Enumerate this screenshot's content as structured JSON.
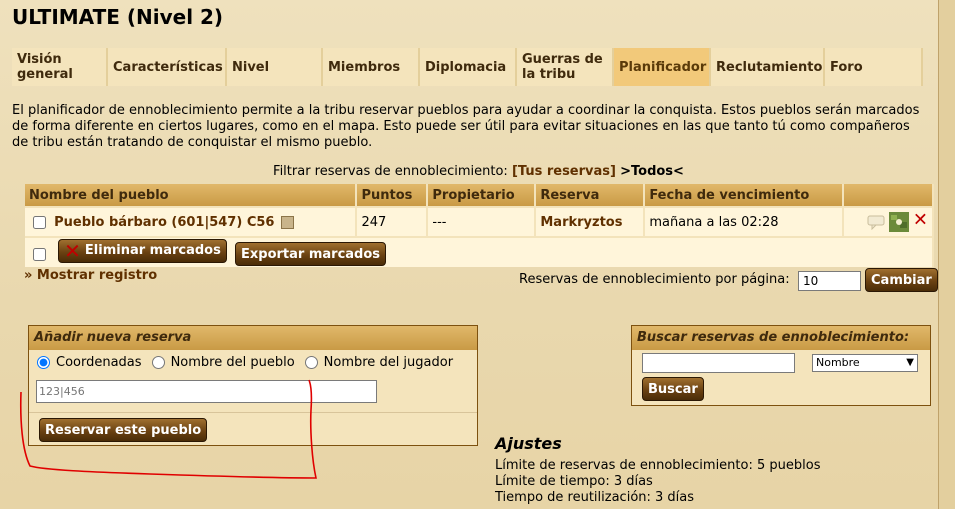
{
  "page_title": "ULTIMATE (Nivel 2)",
  "tabs": [
    {
      "label": "Visión general",
      "active": false
    },
    {
      "label": "Características",
      "active": false
    },
    {
      "label": "Nivel",
      "active": false
    },
    {
      "label": "Miembros",
      "active": false
    },
    {
      "label": "Diplomacia",
      "active": false
    },
    {
      "label": "Guerras de la tribu",
      "active": false
    },
    {
      "label": "Planificador",
      "active": true
    },
    {
      "label": "Reclutamiento",
      "active": false
    },
    {
      "label": "Foro",
      "active": false
    }
  ],
  "intro_text": "El planificador de ennoblecimiento permite a la tribu reservar pueblos para ayudar a coordinar la conquista. Estos pueblos serán marcados de forma diferente en ciertos lugares, como en el mapa. Esto puede ser útil para evitar situaciones en las que tanto tú como compañeros de tribu están tratando de conquistar el mismo pueblo.",
  "filter": {
    "label": "Filtrar reservas de ennoblecimiento:",
    "option_mine": "[Tus reservas]",
    "option_all": ">Todos<"
  },
  "table": {
    "headers": [
      "Nombre del pueblo",
      "Puntos",
      "Propietario",
      "Reserva",
      "Fecha de vencimiento",
      ""
    ],
    "rows": [
      {
        "village": "Pueblo bárbaro (601|547) C56",
        "points": "247",
        "owner": "---",
        "reserved_by": "Markryztos",
        "expires": "mañana a las 02:28"
      }
    ],
    "delete_marked_label": "Eliminar marcados",
    "export_marked_label": "Exportar marcados"
  },
  "show_log_label": "» Mostrar registro",
  "per_page": {
    "label": "Reservas de ennoblecimiento por página:",
    "value": "10",
    "button_label": "Cambiar"
  },
  "add_reservation": {
    "title": "Añadir nueva reserva",
    "radio_options": [
      "Coordenadas",
      "Nombre del pueblo",
      "Nombre del jugador"
    ],
    "selected_option": "Coordenadas",
    "input_placeholder": "123|456",
    "submit_label": "Reservar este pueblo"
  },
  "search_reservations": {
    "title": "Buscar reservas de ennoblecimiento:",
    "select_value": "Nombre",
    "button_label": "Buscar"
  },
  "settings": {
    "title": "Ajustes",
    "lines": [
      "Límite de reservas de ennoblecimiento: 5 pueblos",
      "Límite de tiempo: 3 días",
      "Tiempo de reutilización: 3 días"
    ]
  },
  "colors": {
    "background": "#ecdcb5",
    "header_gradient": "#c99a45",
    "active_tab": "#f2c97a",
    "link": "#603000",
    "button": "#6b4212",
    "annotation_stroke": "#e00000"
  }
}
